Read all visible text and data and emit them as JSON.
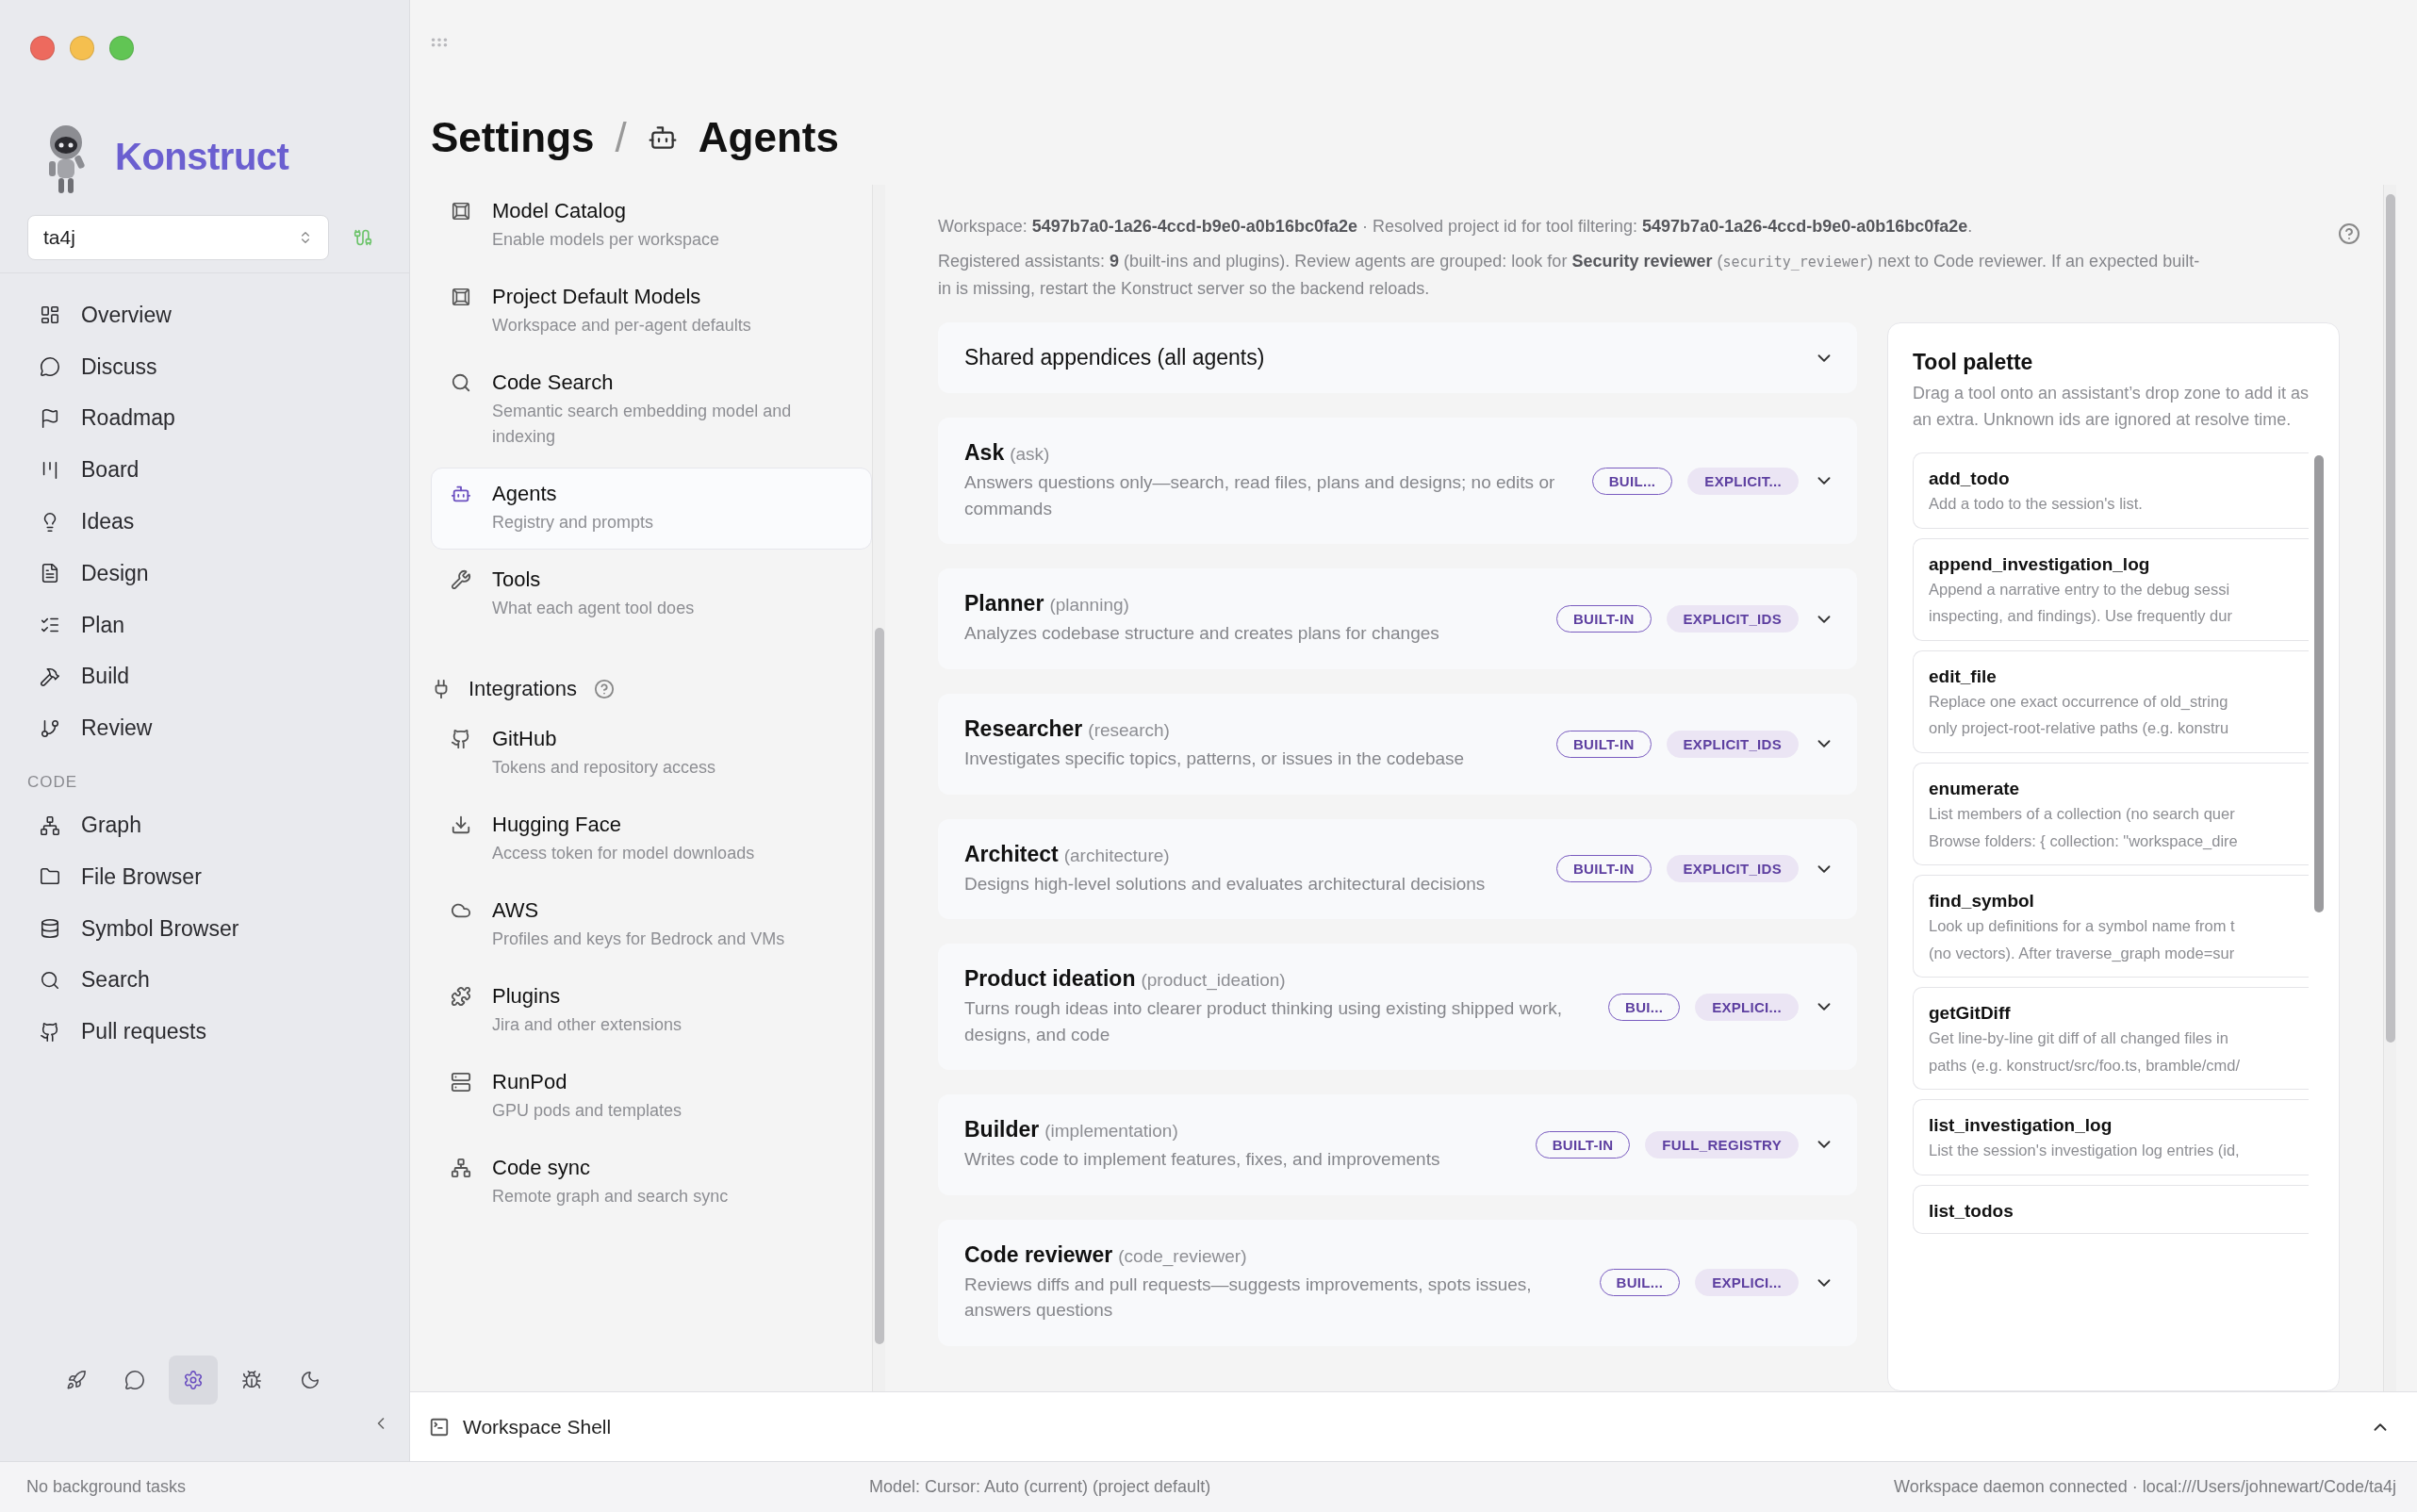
{
  "sidebar": {
    "brand": "Konstruct",
    "project_select": {
      "value": "ta4j"
    },
    "nav": [
      {
        "label": "Overview",
        "selected": false
      },
      {
        "label": "Discuss",
        "selected": false
      },
      {
        "label": "Roadmap",
        "selected": false
      },
      {
        "label": "Board",
        "selected": false
      },
      {
        "label": "Ideas",
        "selected": false
      },
      {
        "label": "Design",
        "selected": false
      },
      {
        "label": "Plan",
        "selected": false
      },
      {
        "label": "Build",
        "selected": false
      },
      {
        "label": "Review",
        "selected": false
      }
    ],
    "code_heading": "CODE",
    "code_nav": [
      {
        "label": "Graph",
        "selected": false
      },
      {
        "label": "File Browser",
        "selected": false
      },
      {
        "label": "Symbol Browser",
        "selected": false
      },
      {
        "label": "Search",
        "selected": false
      },
      {
        "label": "Pull requests",
        "selected": false
      }
    ],
    "bottom_tools": [
      {
        "selected": false
      },
      {
        "selected": false
      },
      {
        "selected": true
      },
      {
        "selected": false
      },
      {
        "selected": false
      }
    ]
  },
  "header": {
    "title": "Settings",
    "separator": "/",
    "page": "Agents"
  },
  "settings_nav": [
    {
      "title": "Model Catalog",
      "subtitle": "Enable models per workspace",
      "selected": false
    },
    {
      "title": "Project Default Models",
      "subtitle": "Workspace and per-agent defaults",
      "selected": false
    },
    {
      "title": "Code Search",
      "subtitle": "Semantic search embedding model and indexing",
      "selected": false
    },
    {
      "title": "Agents",
      "subtitle": "Registry and prompts",
      "selected": true
    },
    {
      "title": "Tools",
      "subtitle": "What each agent tool does",
      "selected": false
    }
  ],
  "integrations": {
    "heading": "Integrations",
    "items": [
      {
        "title": "GitHub",
        "subtitle": "Tokens and repository access",
        "selected": false
      },
      {
        "title": "Hugging Face",
        "subtitle": "Access token for model downloads",
        "selected": false
      },
      {
        "title": "AWS",
        "subtitle": "Profiles and keys for Bedrock and VMs",
        "selected": false
      },
      {
        "title": "Plugins",
        "subtitle": "Jira and other extensions",
        "selected": false
      },
      {
        "title": "RunPod",
        "subtitle": "GPU pods and templates",
        "selected": false
      },
      {
        "title": "Code sync",
        "subtitle": "Remote graph and search sync",
        "selected": false
      }
    ]
  },
  "info": {
    "workspace_line": "Workspace: **5497b7a0-1a26-4ccd-b9e0-a0b16bc0fa2e** · Resolved project id for tool filtering: **5497b7a0-1a26-4ccd-b9e0-a0b16bc0fa2e**.",
    "registry_line": {
      "before": "Registered assistants: **9** (built-ins and plugins). Review agents are grouped: look for **Security reviewer** (",
      "code": "security_reviewer",
      "after": ") next to Code reviewer. If an expected built-in is missing, restart the Konstruct server so the backend reloads."
    }
  },
  "shared_appendices": {
    "title": "Shared appendices (all agents)",
    "expanded": false
  },
  "agents": [
    {
      "name": "Ask",
      "id": "(ask)",
      "description": "Answers questions only—search, read files, plans and designs; no edits or commands",
      "expanded": false,
      "badges": [
        {
          "label": "BUIL...",
          "kind": "outline"
        },
        {
          "label": "EXPLICIT...",
          "kind": "filled"
        }
      ]
    },
    {
      "name": "Planner",
      "id": "(planning)",
      "description": "Analyzes codebase structure and creates plans for changes",
      "expanded": false,
      "badges": [
        {
          "label": "BUILT-IN",
          "kind": "outline"
        },
        {
          "label": "EXPLICIT_IDS",
          "kind": "filled"
        }
      ]
    },
    {
      "name": "Researcher",
      "id": "(research)",
      "description": "Investigates specific topics, patterns, or issues in the codebase",
      "expanded": false,
      "badges": [
        {
          "label": "BUILT-IN",
          "kind": "outline"
        },
        {
          "label": "EXPLICIT_IDS",
          "kind": "filled"
        }
      ]
    },
    {
      "name": "Architect",
      "id": "(architecture)",
      "description": "Designs high-level solutions and evaluates architectural decisions",
      "expanded": false,
      "badges": [
        {
          "label": "BUILT-IN",
          "kind": "outline"
        },
        {
          "label": "EXPLICIT_IDS",
          "kind": "filled"
        }
      ]
    },
    {
      "name": "Product ideation",
      "id": "(product_ideation)",
      "description": "Turns rough ideas into clearer product thinking using existing shipped work, designs, and code",
      "expanded": false,
      "badges": [
        {
          "label": "BUI...",
          "kind": "outline"
        },
        {
          "label": "EXPLICI...",
          "kind": "filled"
        }
      ]
    },
    {
      "name": "Builder",
      "id": "(implementation)",
      "description": "Writes code to implement features, fixes, and improvements",
      "expanded": false,
      "badges": [
        {
          "label": "BUILT-IN",
          "kind": "outline"
        },
        {
          "label": "FULL_REGISTRY",
          "kind": "filled"
        }
      ]
    },
    {
      "name": "Code reviewer",
      "id": "(code_reviewer)",
      "description": "Reviews diffs and pull requests—suggests improvements, spots issues, answers questions",
      "expanded": false,
      "badges": [
        {
          "label": "BUIL...",
          "kind": "outline"
        },
        {
          "label": "EXPLICI...",
          "kind": "filled"
        }
      ]
    }
  ],
  "tool_palette": {
    "title": "Tool palette",
    "description": "Drag a tool onto an assistant’s drop zone to add it as an extra. Unknown ids are ignored at resolve time.",
    "tools": [
      {
        "name": "add_todo",
        "lines": [
          "Add a todo to the session's list."
        ]
      },
      {
        "name": "append_investigation_log",
        "lines": [
          "Append a narrative entry to the debug sessi",
          "inspecting, and findings). Use frequently dur"
        ]
      },
      {
        "name": "edit_file",
        "lines": [
          "Replace one exact occurrence of old_string",
          "only project-root-relative paths (e.g. konstru"
        ]
      },
      {
        "name": "enumerate",
        "lines": [
          "List members of a collection (no search quer",
          "Browse folders: { collection: \"workspace_dire"
        ]
      },
      {
        "name": "find_symbol",
        "lines": [
          "Look up definitions for a symbol name from t",
          "(no vectors). After traverse_graph mode=sur"
        ]
      },
      {
        "name": "getGitDiff",
        "lines": [
          "Get line-by-line git diff of all changed files in",
          "paths (e.g. konstruct/src/foo.ts, bramble/cmd/"
        ]
      },
      {
        "name": "list_investigation_log",
        "lines": [
          "List the session's investigation log entries (id,"
        ]
      },
      {
        "name": "list_todos"
      }
    ]
  },
  "shell_bar": {
    "title": "Workspace Shell",
    "expanded": false
  },
  "status_bar": {
    "left": "No background tasks",
    "center": "Model: Cursor: Auto (current) (project default)",
    "right": "Workspace daemon connected · local:///Users/johnewart/Code/ta4j"
  }
}
